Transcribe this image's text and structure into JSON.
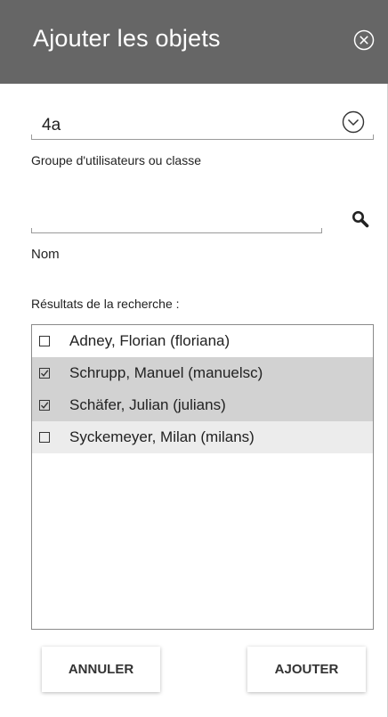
{
  "header": {
    "title": "Ajouter les objets",
    "close_icon": "close-circle-icon",
    "background": "#666666"
  },
  "group_select": {
    "value": "4a",
    "label": "Groupe d'utilisateurs ou classe",
    "icon": "chevron-down-circle-icon"
  },
  "name_search": {
    "value": "",
    "label": "Nom",
    "icon": "search-icon"
  },
  "results": {
    "label": "Résultats de la recherche :",
    "items": [
      {
        "label": "Adney, Florian (floriana)",
        "checked": false
      },
      {
        "label": "Schrupp, Manuel (manuelsc)",
        "checked": true
      },
      {
        "label": "Schäfer, Julian (julians)",
        "checked": true
      },
      {
        "label": "Syckemeyer, Milan (milans)",
        "checked": false
      }
    ],
    "checked_background": "#d2d2d2",
    "hover_background": "#ececec"
  },
  "actions": {
    "cancel_label": "ANNULER",
    "add_label": "AJOUTER"
  }
}
